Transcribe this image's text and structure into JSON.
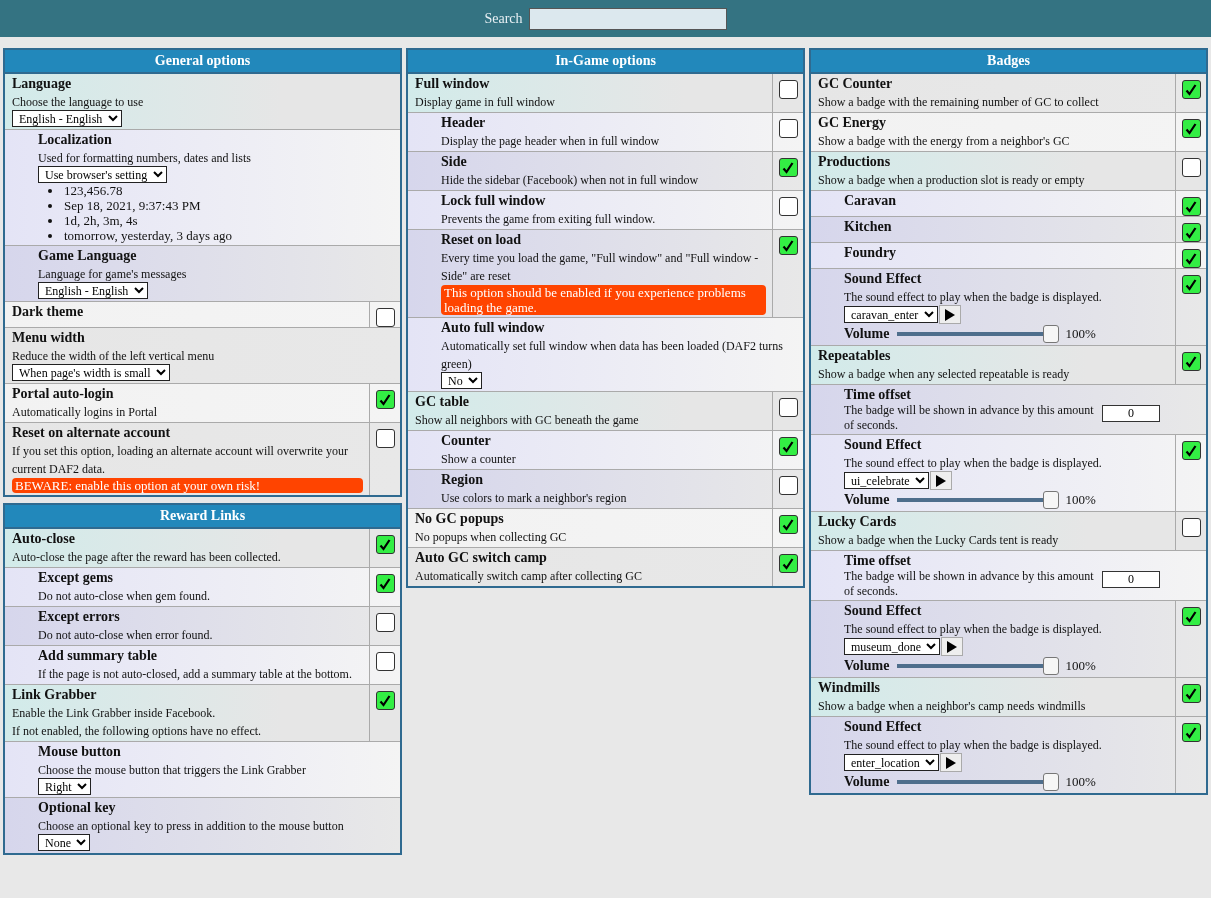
{
  "search": {
    "label": "Search"
  },
  "columns": [
    [
      {
        "title": "General options",
        "rows": [
          {
            "title": "Language",
            "description": "Choose the language to use",
            "select": "English - English",
            "children": [
              {
                "title": "Localization",
                "description": "Used for formatting numbers, dates and lists",
                "select": "Use browser's setting",
                "bullets": [
                  "123,456.78",
                  "Sep 18, 2021, 9:37:43 PM",
                  "1d, 2h, 3m, 4s",
                  "tomorrow, yesterday, 3 days ago"
                ]
              },
              {
                "title": "Game Language",
                "description": "Language for game's messages",
                "select": "English - English"
              }
            ]
          },
          {
            "title": "Dark theme",
            "checked": false
          },
          {
            "title": "Menu width",
            "description": "Reduce the width of the left vertical menu",
            "select": "When page's width is small"
          },
          {
            "title": "Portal auto-login",
            "description": "Automatically logins in Portal",
            "checked": true
          },
          {
            "title": "Reset on alternate account",
            "description": "If you set this option, loading an alternate account will overwrite your current DAF2 data.",
            "warning": "BEWARE: enable this option at your own risk!",
            "checked": false
          }
        ]
      },
      {
        "title": "Reward Links",
        "rows": [
          {
            "title": "Auto-close",
            "description": "Auto-close the page after the reward has been collected.",
            "checked": true,
            "children": [
              {
                "title": "Except gems",
                "description": "Do not auto-close when gem found.",
                "checked": true
              },
              {
                "title": "Except errors",
                "description": "Do not auto-close when error found.",
                "checked": false
              },
              {
                "title": "Add summary table",
                "description": "If the page is not auto-closed, add a summary table at the bottom.",
                "checked": false
              }
            ]
          },
          {
            "title": "Link Grabber",
            "description": "Enable the Link Grabber inside Facebook.\nIf not enabled, the following options have no effect.",
            "checked": true,
            "children": [
              {
                "title": "Mouse button",
                "description": "Choose the mouse button that triggers the Link Grabber",
                "select": "Right"
              },
              {
                "title": "Optional key",
                "description": "Choose an optional key to press in addition to the mouse button",
                "select": "None"
              }
            ]
          }
        ]
      }
    ],
    [
      {
        "title": "In-Game options",
        "rows": [
          {
            "title": "Full window",
            "description": "Display game in full window",
            "checked": false,
            "children": [
              {
                "title": "Header",
                "description": "Display the page header when in full window",
                "checked": false
              },
              {
                "title": "Side",
                "description": "Hide the sidebar (Facebook) when not in full window",
                "checked": true
              },
              {
                "title": "Lock full window",
                "description": "Prevents the game from exiting full window.",
                "checked": false
              },
              {
                "title": "Reset on load",
                "description": "Every time you load the game, \"Full window\" and \"Full window - Side\" are reset",
                "warning": "This option should be enabled if you experience problems loading the game.",
                "checked": true
              },
              {
                "title": "Auto full window",
                "description": "Automatically set full window when data has been loaded (DAF2 turns green)",
                "select": "No"
              }
            ]
          },
          {
            "title": "GC table",
            "description": "Show all neighbors with GC beneath the game",
            "checked": false,
            "children": [
              {
                "title": "Counter",
                "description": "Show a counter",
                "checked": true
              },
              {
                "title": "Region",
                "description": "Use colors to mark a neighbor's region",
                "checked": false
              }
            ]
          },
          {
            "title": "No GC popups",
            "description": "No popups when collecting GC",
            "checked": true
          },
          {
            "title": "Auto GC switch camp",
            "description": "Automatically switch camp after collecting GC",
            "checked": true
          }
        ]
      }
    ],
    [
      {
        "title": "Badges",
        "rows": [
          {
            "title": "GC Counter",
            "description": "Show a badge with the remaining number of GC to collect",
            "checked": true
          },
          {
            "title": "GC Energy",
            "description": "Show a badge with the energy from a neighbor's GC",
            "checked": true
          },
          {
            "title": "Productions",
            "description": "Show a badge when a production slot is ready or empty",
            "checked": false,
            "children": [
              {
                "title": "Caravan",
                "checked": true
              },
              {
                "title": "Kitchen",
                "checked": true
              },
              {
                "title": "Foundry",
                "checked": true
              },
              {
                "title": "Sound Effect",
                "description": "The sound effect to play when the badge is displayed.",
                "select": "caravan_enter",
                "volume": {
                  "label": "Volume",
                  "level": 1,
                  "reading": "100%"
                },
                "checked": true
              }
            ]
          },
          {
            "title": "Repeatables",
            "description": "Show a badge when any selected repeatable is ready",
            "checked": true,
            "children": [
              {
                "title": "Time offset",
                "description": "The badge will be shown in advance by this amount of seconds.",
                "number": "0"
              },
              {
                "title": "Sound Effect",
                "description": "The sound effect to play when the badge is displayed.",
                "select": "ui_celebrate",
                "volume": {
                  "label": "Volume",
                  "level": 1,
                  "reading": "100%"
                },
                "checked": true
              }
            ]
          },
          {
            "title": "Lucky Cards",
            "description": "Show a badge when the Lucky Cards tent is ready",
            "checked": false,
            "children": [
              {
                "title": "Time offset",
                "description": "The badge will be shown in advance by this amount of seconds.",
                "number": "0"
              },
              {
                "title": "Sound Effect",
                "description": "The sound effect to play when the badge is displayed.",
                "select": "museum_done",
                "volume": {
                  "label": "Volume",
                  "level": 1,
                  "reading": "100%"
                },
                "checked": true
              }
            ]
          },
          {
            "title": "Windmills",
            "description": "Show a badge when a neighbor's camp needs windmills",
            "checked": true,
            "children": [
              {
                "title": "Sound Effect",
                "description": "The sound effect to play when the badge is displayed.",
                "select": "enter_location",
                "volume": {
                  "label": "Volume",
                  "level": 1,
                  "reading": "100%"
                },
                "checked": true
              }
            ]
          }
        ]
      }
    ]
  ]
}
